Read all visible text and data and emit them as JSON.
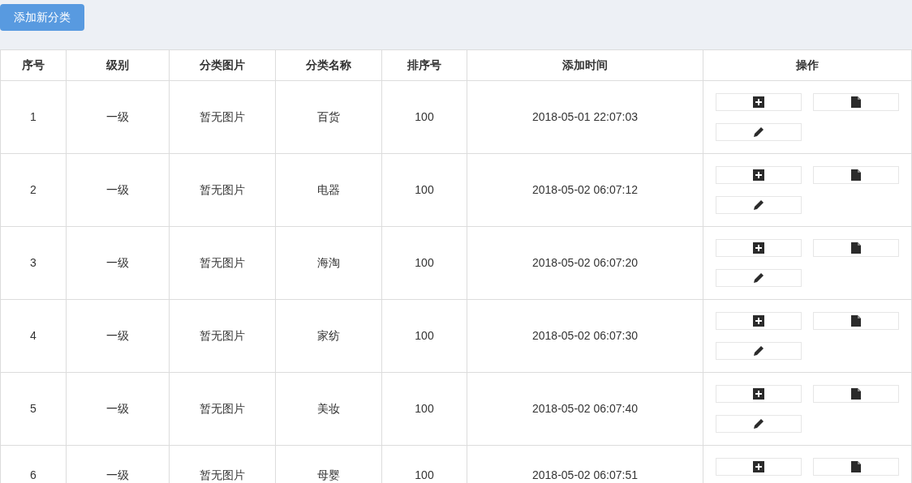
{
  "toolbar": {
    "add_button": "添加新分类"
  },
  "table": {
    "columns": [
      "序号",
      "级别",
      "分类图片",
      "分类名称",
      "排序号",
      "添加时间",
      "操作"
    ],
    "rows": [
      {
        "index": "1",
        "grade": "一级",
        "image_text": "暂无图片",
        "name": "百货",
        "sort": "100",
        "added": "2018-05-01 22:07:03",
        "actions": [
          {
            "kind": "add"
          },
          {
            "kind": "file"
          },
          {
            "kind": "edit"
          }
        ]
      },
      {
        "index": "2",
        "grade": "一级",
        "image_text": "暂无图片",
        "name": "电器",
        "sort": "100",
        "added": "2018-05-02 06:07:12",
        "actions": [
          {
            "kind": "add"
          },
          {
            "kind": "file"
          },
          {
            "kind": "edit"
          }
        ]
      },
      {
        "index": "3",
        "grade": "一级",
        "image_text": "暂无图片",
        "name": "海淘",
        "sort": "100",
        "added": "2018-05-02 06:07:20",
        "actions": [
          {
            "kind": "add"
          },
          {
            "kind": "file"
          },
          {
            "kind": "edit"
          }
        ]
      },
      {
        "index": "4",
        "grade": "一级",
        "image_text": "暂无图片",
        "name": "家纺",
        "sort": "100",
        "added": "2018-05-02 06:07:30",
        "actions": [
          {
            "kind": "add"
          },
          {
            "kind": "file"
          },
          {
            "kind": "edit"
          }
        ]
      },
      {
        "index": "5",
        "grade": "一级",
        "image_text": "暂无图片",
        "name": "美妆",
        "sort": "100",
        "added": "2018-05-02 06:07:40",
        "actions": [
          {
            "kind": "add"
          },
          {
            "kind": "file"
          },
          {
            "kind": "edit"
          }
        ]
      },
      {
        "index": "6",
        "grade": "一级",
        "image_text": "暂无图片",
        "name": "母婴",
        "sort": "100",
        "added": "2018-05-02 06:07:51",
        "actions": [
          {
            "kind": "add"
          },
          {
            "kind": "file"
          }
        ]
      }
    ]
  }
}
